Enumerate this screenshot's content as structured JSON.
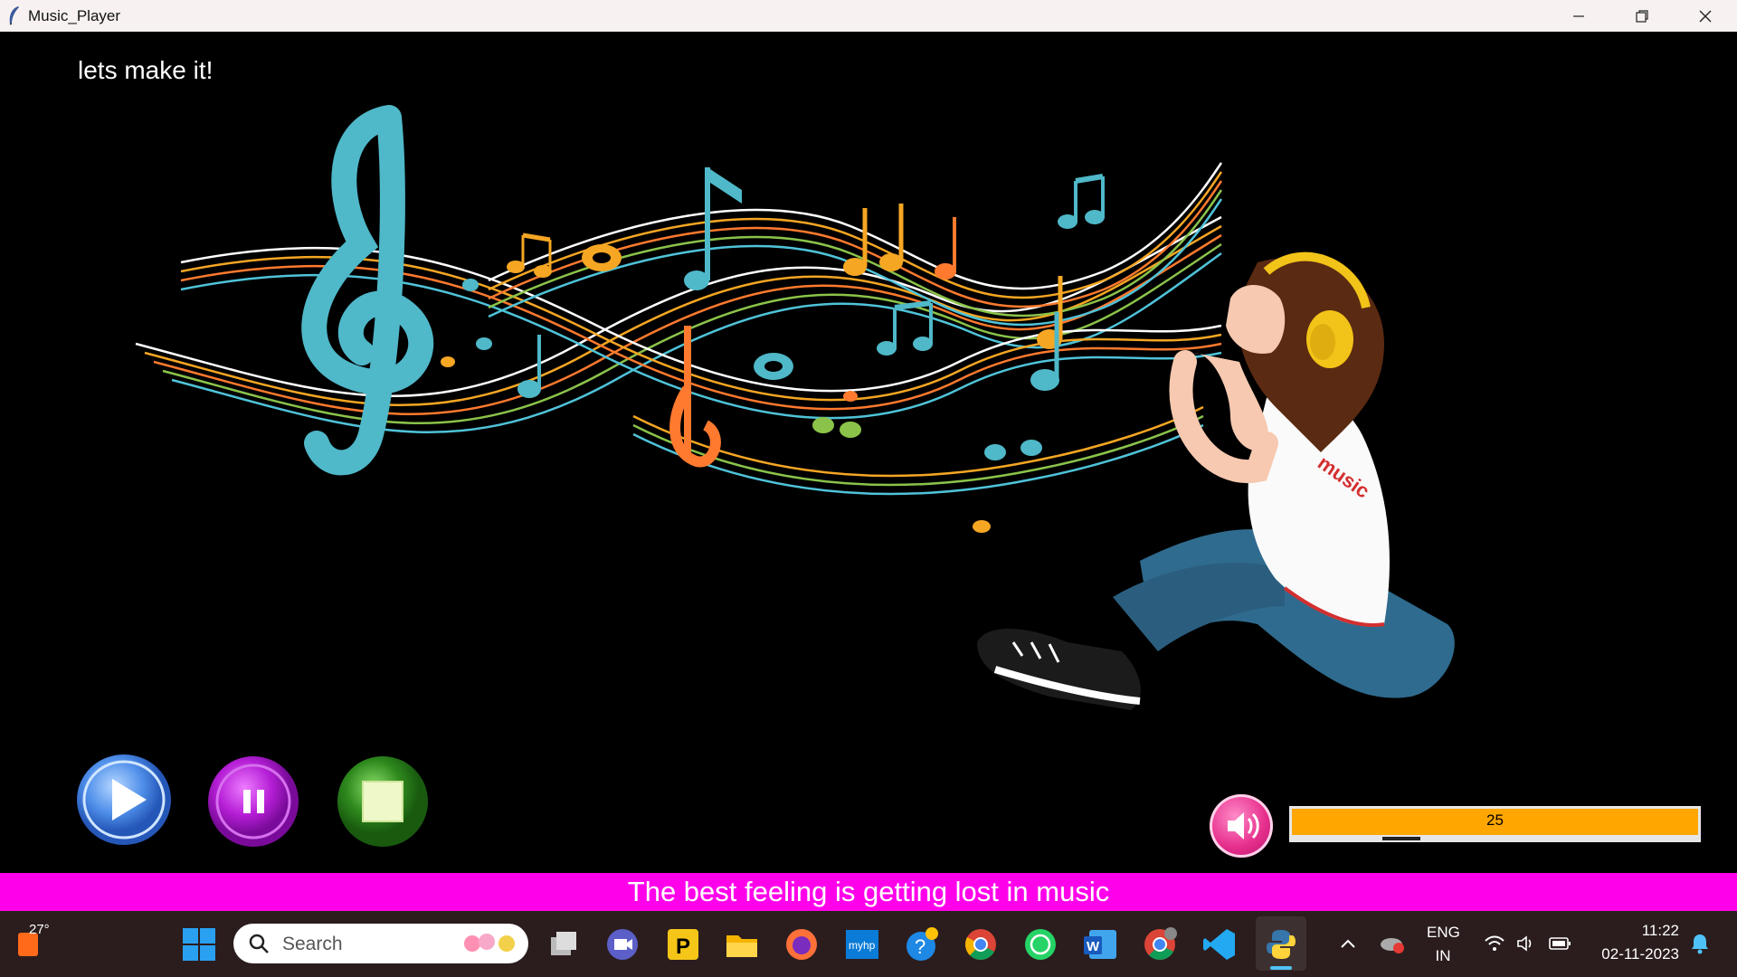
{
  "window": {
    "title": "Music_Player",
    "controls": [
      "minimize",
      "restore",
      "close"
    ]
  },
  "main": {
    "tagline": "lets make it!",
    "girl_shirt_text": "music",
    "player_controls": [
      {
        "name": "play",
        "icon": "play-icon",
        "color": "#4f8fea"
      },
      {
        "name": "pause",
        "icon": "pause-icon",
        "color": "#b51fd6"
      },
      {
        "name": "stop",
        "icon": "stop-icon",
        "color": "#2f8a1e"
      }
    ],
    "volume": {
      "value": "25",
      "fraction": 0.25,
      "fill_color": "#ffa600",
      "icon": "speaker-icon"
    },
    "banner_text": "The best feeling is getting lost in music",
    "banner_color": "#ff00ea"
  },
  "taskbar": {
    "weather": "27°",
    "search_placeholder": "Search",
    "apps": [
      "windows-start",
      "task-view",
      "teams-meet",
      "plex",
      "file-explorer",
      "firefox",
      "myhp",
      "get-help",
      "chrome",
      "whatsapp",
      "word",
      "chrome-profile",
      "vscode",
      "python"
    ],
    "language_line1": "ENG",
    "language_line2": "IN",
    "time": "11:22",
    "date": "02-11-2023"
  }
}
